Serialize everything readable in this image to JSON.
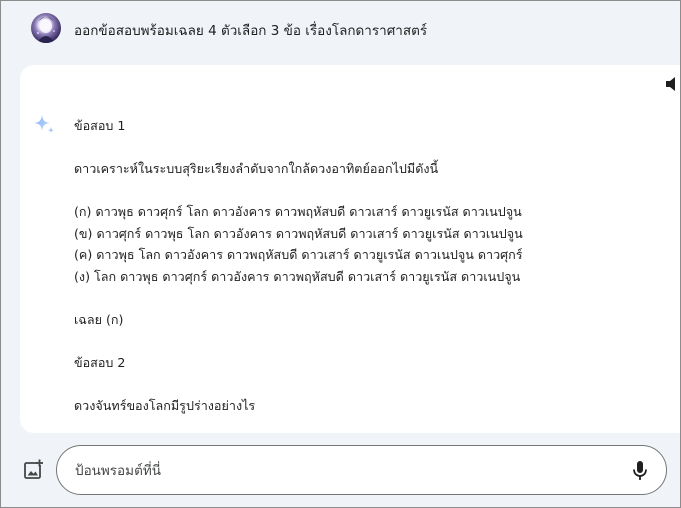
{
  "prompt": {
    "text": "ออกข้อสอบพร้อมเฉลย 4 ตัวเลือก 3 ข้อ เรื่องโลกดาราศาสตร์",
    "avatar_icon": "user-avatar"
  },
  "response": {
    "icon": "gemini-sparkle-icon",
    "speaker_icon": "speaker-icon",
    "question1": {
      "heading": "ข้อสอบ 1",
      "question": "ดาวเคราะห์ในระบบสุริยะเรียงลำดับจากใกล้ดวงอาทิตย์ออกไปมีดังนี้",
      "options": [
        "(ก) ดาวพุธ ดาวศุกร์ โลก ดาวอังคาร ดาวพฤหัสบดี ดาวเสาร์ ดาวยูเรนัส ดาวเนปจูน",
        "(ข) ดาวศุกร์ ดาวพุธ โลก ดาวอังคาร ดาวพฤหัสบดี ดาวเสาร์ ดาวยูเรนัส ดาวเนปจูน",
        "(ค) ดาวพุธ โลก ดาวอังคาร ดาวพฤหัสบดี ดาวเสาร์ ดาวยูเรนัส ดาวเนปจูน ดาวศุกร์",
        "(ง) โลก ดาวพุธ ดาวศุกร์ ดาวอังคาร ดาวพฤหัสบดี ดาวเสาร์ ดาวยูเรนัส ดาวเนปจูน"
      ],
      "answer": "เฉลย (ก)"
    },
    "question2": {
      "heading": "ข้อสอบ 2",
      "question": "ดวงจันทร์ของโลกมีรูปร่างอย่างไร"
    }
  },
  "input": {
    "placeholder": "ป้อนพรอมต์ที่นี่",
    "value": "",
    "image_icon": "add-image-icon",
    "mic_icon": "microphone-icon"
  },
  "colors": {
    "background": "#f0f4f9",
    "card": "#ffffff",
    "text": "#1f1f1f",
    "sparkle": "#a8c7fa"
  }
}
